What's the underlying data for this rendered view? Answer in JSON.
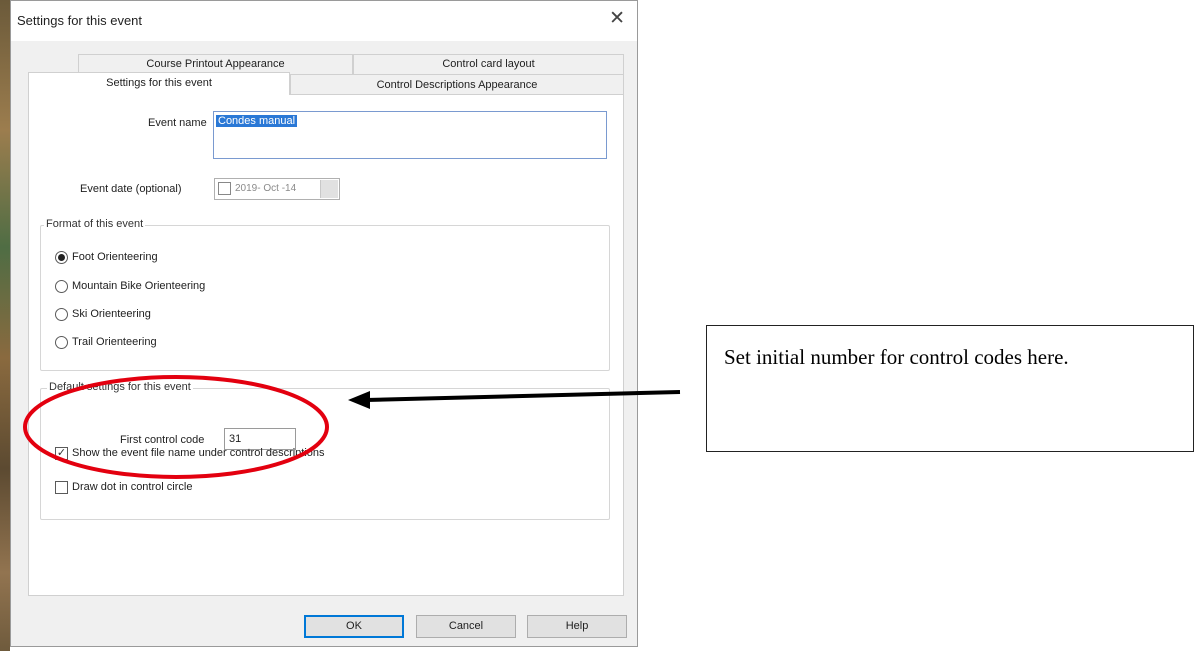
{
  "dialog": {
    "title": "Settings for this event",
    "close_icon": "close-icon"
  },
  "tabs": {
    "back_row": [
      "Course Printout Appearance",
      "Control card layout"
    ],
    "front_row": [
      "Settings for this event",
      "Control Descriptions Appearance"
    ],
    "active": "Settings for this event"
  },
  "event_name": {
    "label": "Event name",
    "value": "Condes manual"
  },
  "event_date": {
    "label": "Event date (optional)",
    "value": "2019- Oct -14",
    "checked": false
  },
  "format": {
    "legend": "Format of this event",
    "options": [
      "Foot Orienteering",
      "Mountain Bike Orienteering",
      "Ski Orienteering",
      "Trail Orienteering"
    ],
    "selected": "Foot Orienteering"
  },
  "defaults": {
    "legend": "Default settings for this event",
    "first_code_label": "First control code",
    "first_code_value": "31",
    "checkboxes": [
      {
        "label": "Show the event file name under control descriptions",
        "checked": true
      },
      {
        "label": "Draw dot in control circle",
        "checked": false
      }
    ]
  },
  "buttons": {
    "ok": "OK",
    "cancel": "Cancel",
    "help": "Help"
  },
  "annotation": {
    "text": "Set initial number for control codes here.",
    "highlight_color": "#e3000f",
    "arrow_color": "#000000"
  }
}
